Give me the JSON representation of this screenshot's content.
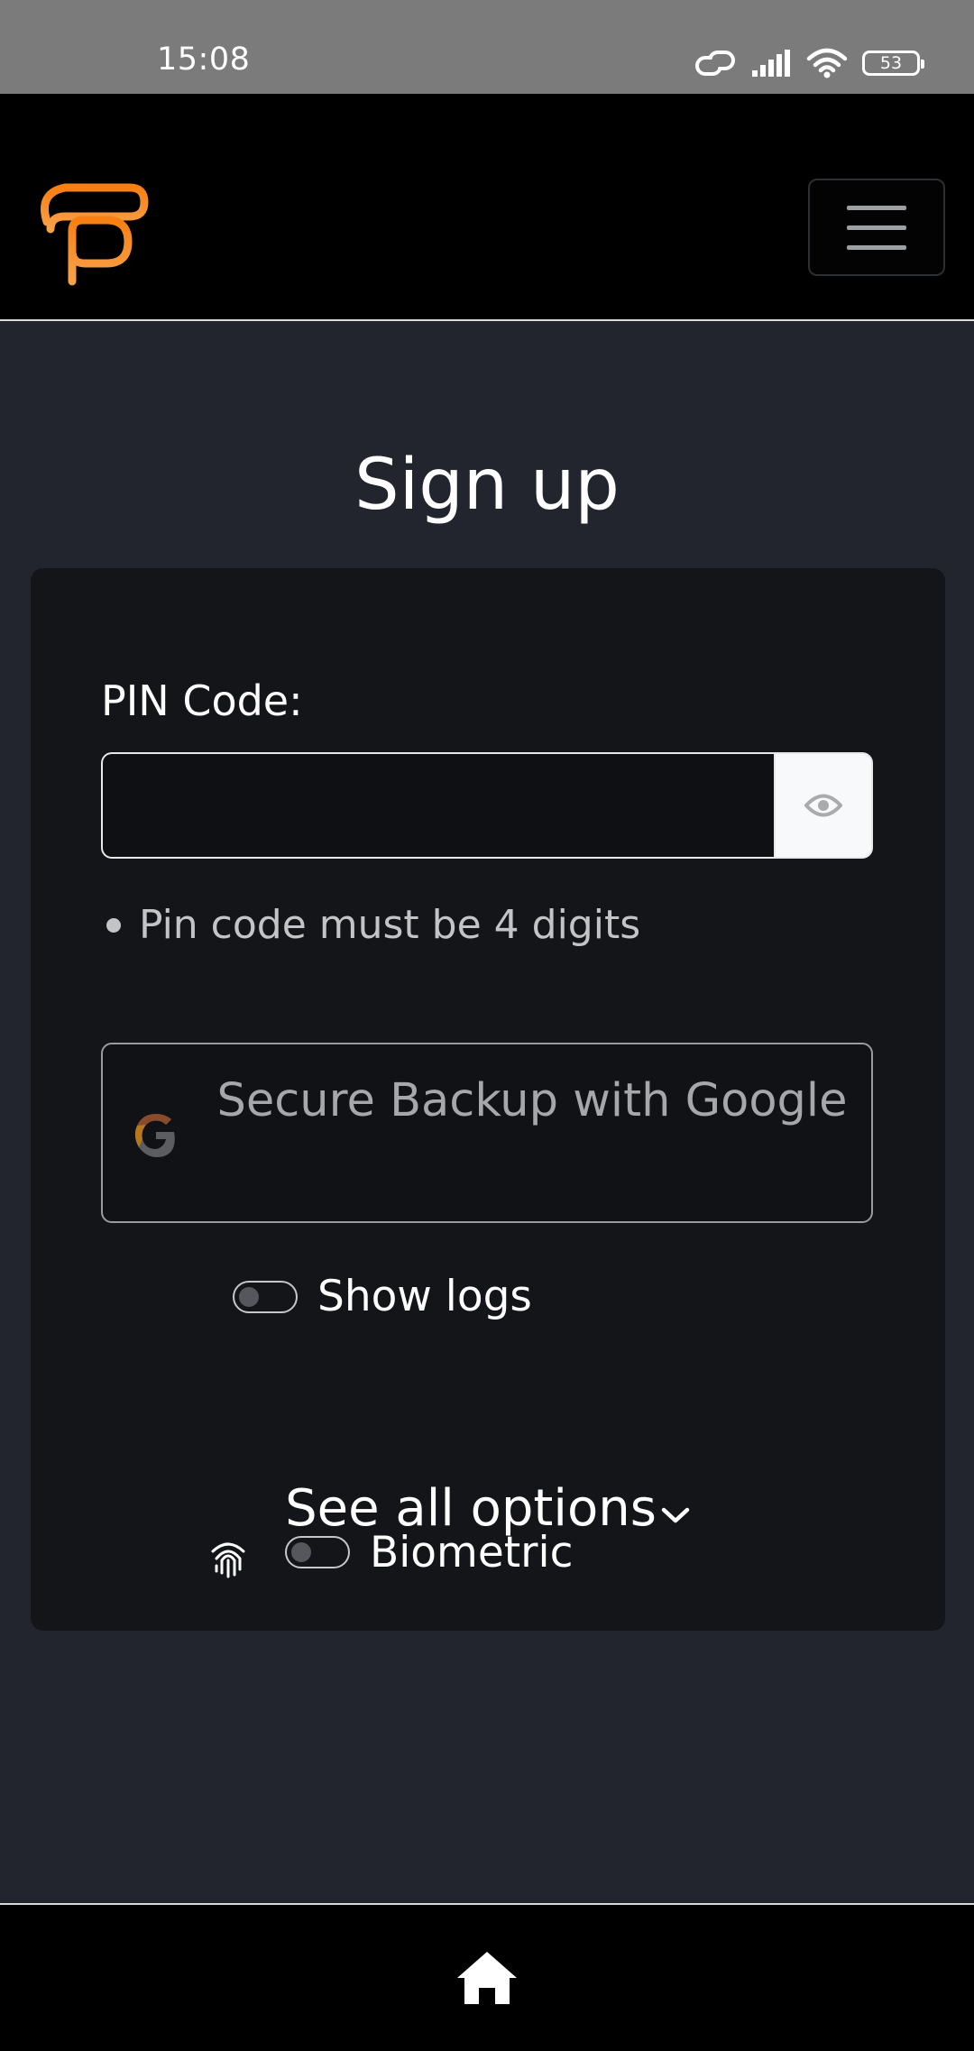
{
  "status_bar": {
    "time": "15:08",
    "battery": "53",
    "icons": [
      "link-icon",
      "signal-icon",
      "wifi-icon",
      "battery-icon"
    ]
  },
  "header": {
    "logo_icon": "brand-logo",
    "menu_icon": "hamburger-icon",
    "accent_color": "#f7931a"
  },
  "page": {
    "title": "Sign up"
  },
  "form": {
    "pin_label": "PIN Code:",
    "pin_value": "",
    "reveal_icon": "eye-icon",
    "rules": [
      "Pin code must be 4 digits"
    ],
    "google_backup_label": "Secure Backup with Google",
    "show_logs_label": "Show logs",
    "show_logs_on": false,
    "see_all_label": "See all options",
    "biometric_label": "Biometric",
    "biometric_on": false
  },
  "bottom_nav": {
    "home_icon": "home-icon"
  }
}
